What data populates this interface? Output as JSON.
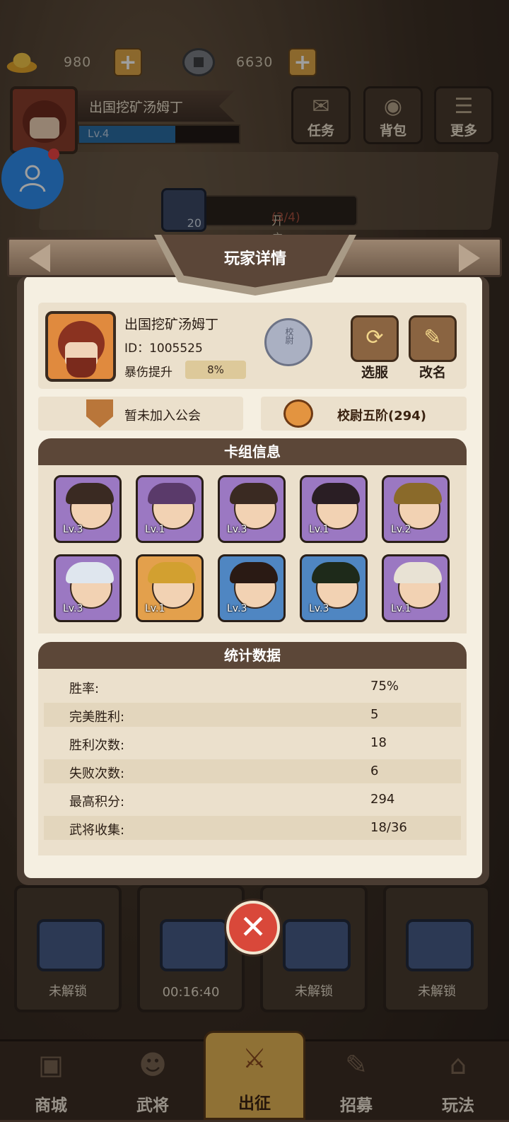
{
  "currency": {
    "gold_icon": "gold-ingot-icon",
    "gold": "980",
    "coin_icon": "copper-coin-icon",
    "coins": "6630",
    "plus": "+"
  },
  "profile": {
    "name": "出国挖矿汤姆丁",
    "level": "Lv.4",
    "level_progress": 0.6
  },
  "top_buttons": [
    {
      "label": "任务",
      "icon": "scroll-icon"
    },
    {
      "label": "背包",
      "icon": "bag-icon"
    },
    {
      "label": "更多",
      "icon": "list-icon"
    }
  ],
  "chest_quest": {
    "count": "20",
    "text": "开启任意宝箱",
    "progress": "(3/4)"
  },
  "background_slots": [
    {
      "status": "未解锁"
    },
    {
      "status": "00:16:40"
    },
    {
      "status": "未解锁"
    },
    {
      "status": "未解锁"
    }
  ],
  "nav": [
    {
      "label": "商城",
      "icon": "shop-icon"
    },
    {
      "label": "武将",
      "icon": "general-icon"
    },
    {
      "label": "出征",
      "icon": "battle-icon"
    },
    {
      "label": "招募",
      "icon": "recruit-icon"
    },
    {
      "label": "玩法",
      "icon": "temple-icon"
    }
  ],
  "modal": {
    "title": "玩家详情",
    "player": {
      "name": "出国挖矿汤姆丁",
      "id": "ID：1005525",
      "crit_label": "暴伤提升",
      "crit_value": "8%",
      "rank_badge": "校尉"
    },
    "buttons": {
      "switch_server": "选服",
      "rename": "改名"
    },
    "guild": "暂未加入公会",
    "rank": "校尉五阶(294)",
    "deck_title": "卡组信息",
    "deck": [
      {
        "level": "Lv.3",
        "rarity": "purple"
      },
      {
        "level": "Lv.1",
        "rarity": "purple"
      },
      {
        "level": "Lv.3",
        "rarity": "purple"
      },
      {
        "level": "Lv.1",
        "rarity": "purple"
      },
      {
        "level": "Lv.2",
        "rarity": "purple"
      },
      {
        "level": "Lv.3",
        "rarity": "purple"
      },
      {
        "level": "Lv.1",
        "rarity": "orange"
      },
      {
        "level": "Lv.3",
        "rarity": "blue"
      },
      {
        "level": "Lv.3",
        "rarity": "blue"
      },
      {
        "level": "Lv.1",
        "rarity": "purple"
      }
    ],
    "stats_title": "统计数据",
    "stats": [
      {
        "key": "胜率:",
        "value": "75%"
      },
      {
        "key": "完美胜利:",
        "value": "5"
      },
      {
        "key": "胜利次数:",
        "value": "18"
      },
      {
        "key": "失败次数:",
        "value": "6"
      },
      {
        "key": "最高积分:",
        "value": "294"
      },
      {
        "key": "武将收集:",
        "value": "18/36"
      }
    ],
    "close": "✕"
  },
  "colors": {
    "panel": "#f5efe1",
    "header": "#5c4738",
    "accent": "#e7b656",
    "close": "#d9483a"
  }
}
